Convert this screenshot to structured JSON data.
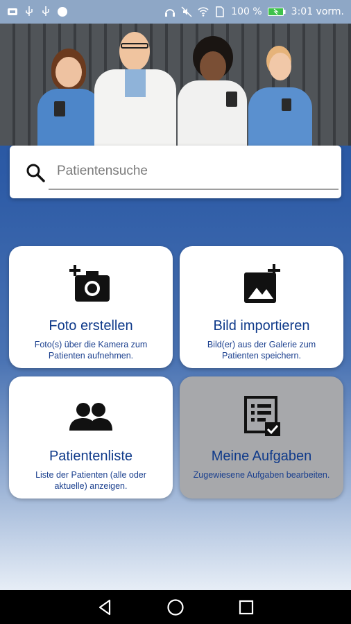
{
  "status_bar": {
    "battery_percent": "100 %",
    "time": "3:01 vorm."
  },
  "search": {
    "placeholder": "Patientensuche",
    "value": ""
  },
  "tiles": [
    {
      "title": "Foto erstellen",
      "desc": "Foto(s) über die Kamera zum Patienten aufnehmen.",
      "icon": "camera-add-icon",
      "enabled": true
    },
    {
      "title": "Bild importieren",
      "desc": "Bild(er) aus der Galerie zum Patienten speichern.",
      "icon": "image-add-icon",
      "enabled": true
    },
    {
      "title": "Patientenliste",
      "desc": "Liste der Patienten (alle oder aktuelle) anzeigen.",
      "icon": "people-icon",
      "enabled": true
    },
    {
      "title": "Meine Aufgaben",
      "desc": "Zugewiesene Aufgaben bearbeiten.",
      "icon": "task-list-icon",
      "enabled": false
    }
  ],
  "colors": {
    "accent": "#0f3a8a",
    "background_top": "#1f4f9a",
    "disabled_tile": "#a7a8ab"
  },
  "nav": {
    "back": "back-icon",
    "home": "home-icon",
    "recents": "recents-icon"
  }
}
